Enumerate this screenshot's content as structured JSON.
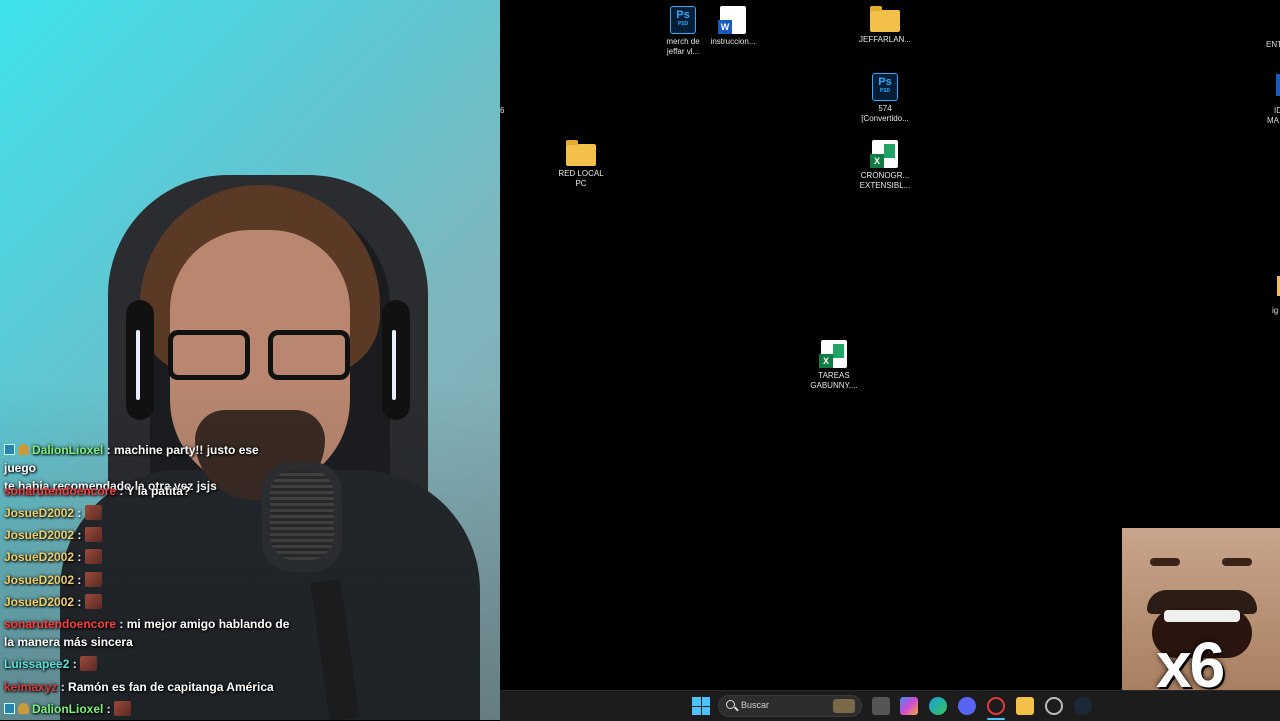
{
  "chat": {
    "messages": [
      {
        "user": "DalionLioxel",
        "text": ": machine party!! justo ese juego",
        "cont": "te habia recomendado la otra vez jsjs",
        "user_color": "#7cf27c",
        "badges": true
      },
      {
        "user": "sonarutendoencore",
        "text": ": Y la patita?",
        "user_color": "#ff3b3b"
      },
      {
        "user": "JosueD2002",
        "text": ":",
        "user_color": "#f0cf6a",
        "emote": true
      },
      {
        "user": "JosueD2002",
        "text": ":",
        "user_color": "#f0cf6a",
        "emote": true
      },
      {
        "user": "JosueD2002",
        "text": ":",
        "user_color": "#f0cf6a",
        "emote": true
      },
      {
        "user": "JosueD2002",
        "text": ":",
        "user_color": "#f0cf6a",
        "emote": true
      },
      {
        "user": "JosueD2002",
        "text": ":",
        "user_color": "#f0cf6a",
        "emote": true
      },
      {
        "user": "sonarutendoencore",
        "text": ": mi mejor amigo hablando de",
        "cont": "la manera más sincera",
        "user_color": "#ff3b3b"
      },
      {
        "user": "Luissapee2",
        "text": ":",
        "user_color": "#5fe0d8",
        "emote": true
      },
      {
        "user": "keimaxyz",
        "text": ": Ramón es fan de capitanga América",
        "user_color": "#d63b3b"
      },
      {
        "user": "DalionLioxel",
        "text": ":",
        "user_color": "#7cf27c",
        "badges": true,
        "emote": true
      }
    ]
  },
  "desktop": {
    "icons": [
      {
        "id": "merch",
        "type": "psd",
        "label1": "merch de",
        "label2": "jeffar vl..."
      },
      {
        "id": "instruc",
        "type": "word",
        "label1": "instruccion...",
        "label2": ""
      },
      {
        "id": "jeffarlan",
        "type": "folder",
        "label1": "JEFFARLAN...",
        "label2": ""
      },
      {
        "id": "574",
        "type": "psd",
        "label1": "574",
        "label2": "[Convertido..."
      },
      {
        "id": "redlocal",
        "type": "folder",
        "label1": "RED LOCAL",
        "label2": "PC"
      },
      {
        "id": "crono",
        "type": "excel",
        "label1": "CRONOGR...",
        "label2": "EXTENSIBL..."
      },
      {
        "id": "tareas",
        "type": "excel",
        "label1": "TAREAS",
        "label2": "GABUNNY...."
      }
    ],
    "edge_labels": [
      "ENT",
      "ID",
      "MA",
      "ig",
      "6"
    ]
  },
  "ps_text": "Ps",
  "ps_sub": "PSD",
  "word_letter": "W",
  "excel_letter": "X",
  "meme": {
    "counter": "x6"
  },
  "taskbar": {
    "search_placeholder": "Buscar",
    "apps": [
      "windows-start",
      "search",
      "task-view",
      "copilot",
      "edge",
      "discord",
      "opera-gx",
      "file-explorer",
      "chrome",
      "steam"
    ]
  }
}
